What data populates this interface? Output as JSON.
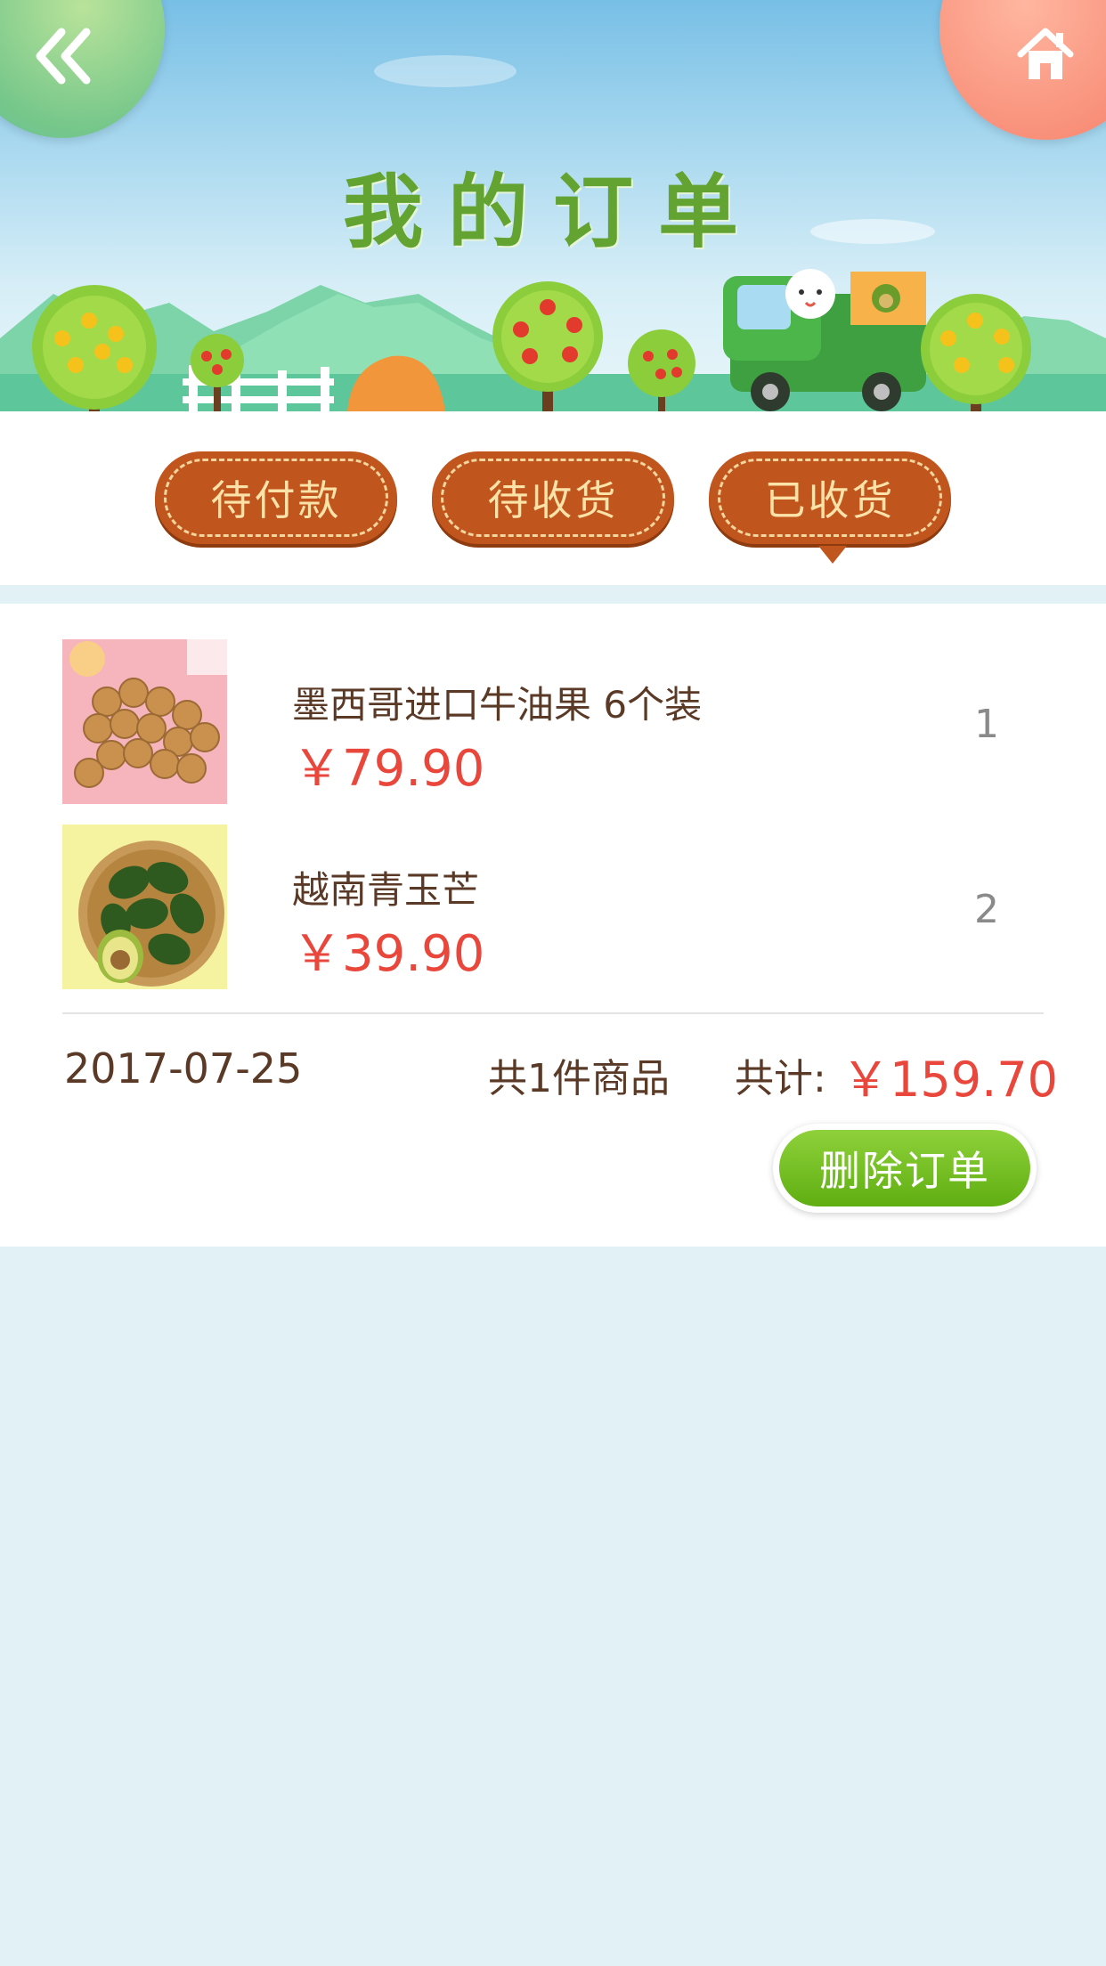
{
  "header": {
    "title": "我的订单",
    "back_icon": "double-chevron-left-icon",
    "home_icon": "home-icon"
  },
  "tabs": [
    {
      "label": "待付款",
      "active": false
    },
    {
      "label": "待收货",
      "active": false
    },
    {
      "label": "已收货",
      "active": true
    }
  ],
  "order": {
    "items": [
      {
        "name": "墨西哥进口牛油果 6个装",
        "price": "￥79.90",
        "quantity": "1",
        "image": "longan-fruit-photo"
      },
      {
        "name": "越南青玉芒",
        "price": "￥39.90",
        "quantity": "2",
        "image": "avocado-basket-photo"
      }
    ],
    "date": "2017-07-25",
    "count_text": "共1件商品",
    "total_label": "共计:",
    "total": "￥159.70",
    "delete_label": "删除订单"
  },
  "colors": {
    "tab_bg": "#c0561d",
    "tab_text": "#fbe2a8",
    "price": "#e9473c",
    "text": "#5a3a26",
    "delete_button": "#6cbb1a",
    "page_bg": "#e2f1f6"
  }
}
